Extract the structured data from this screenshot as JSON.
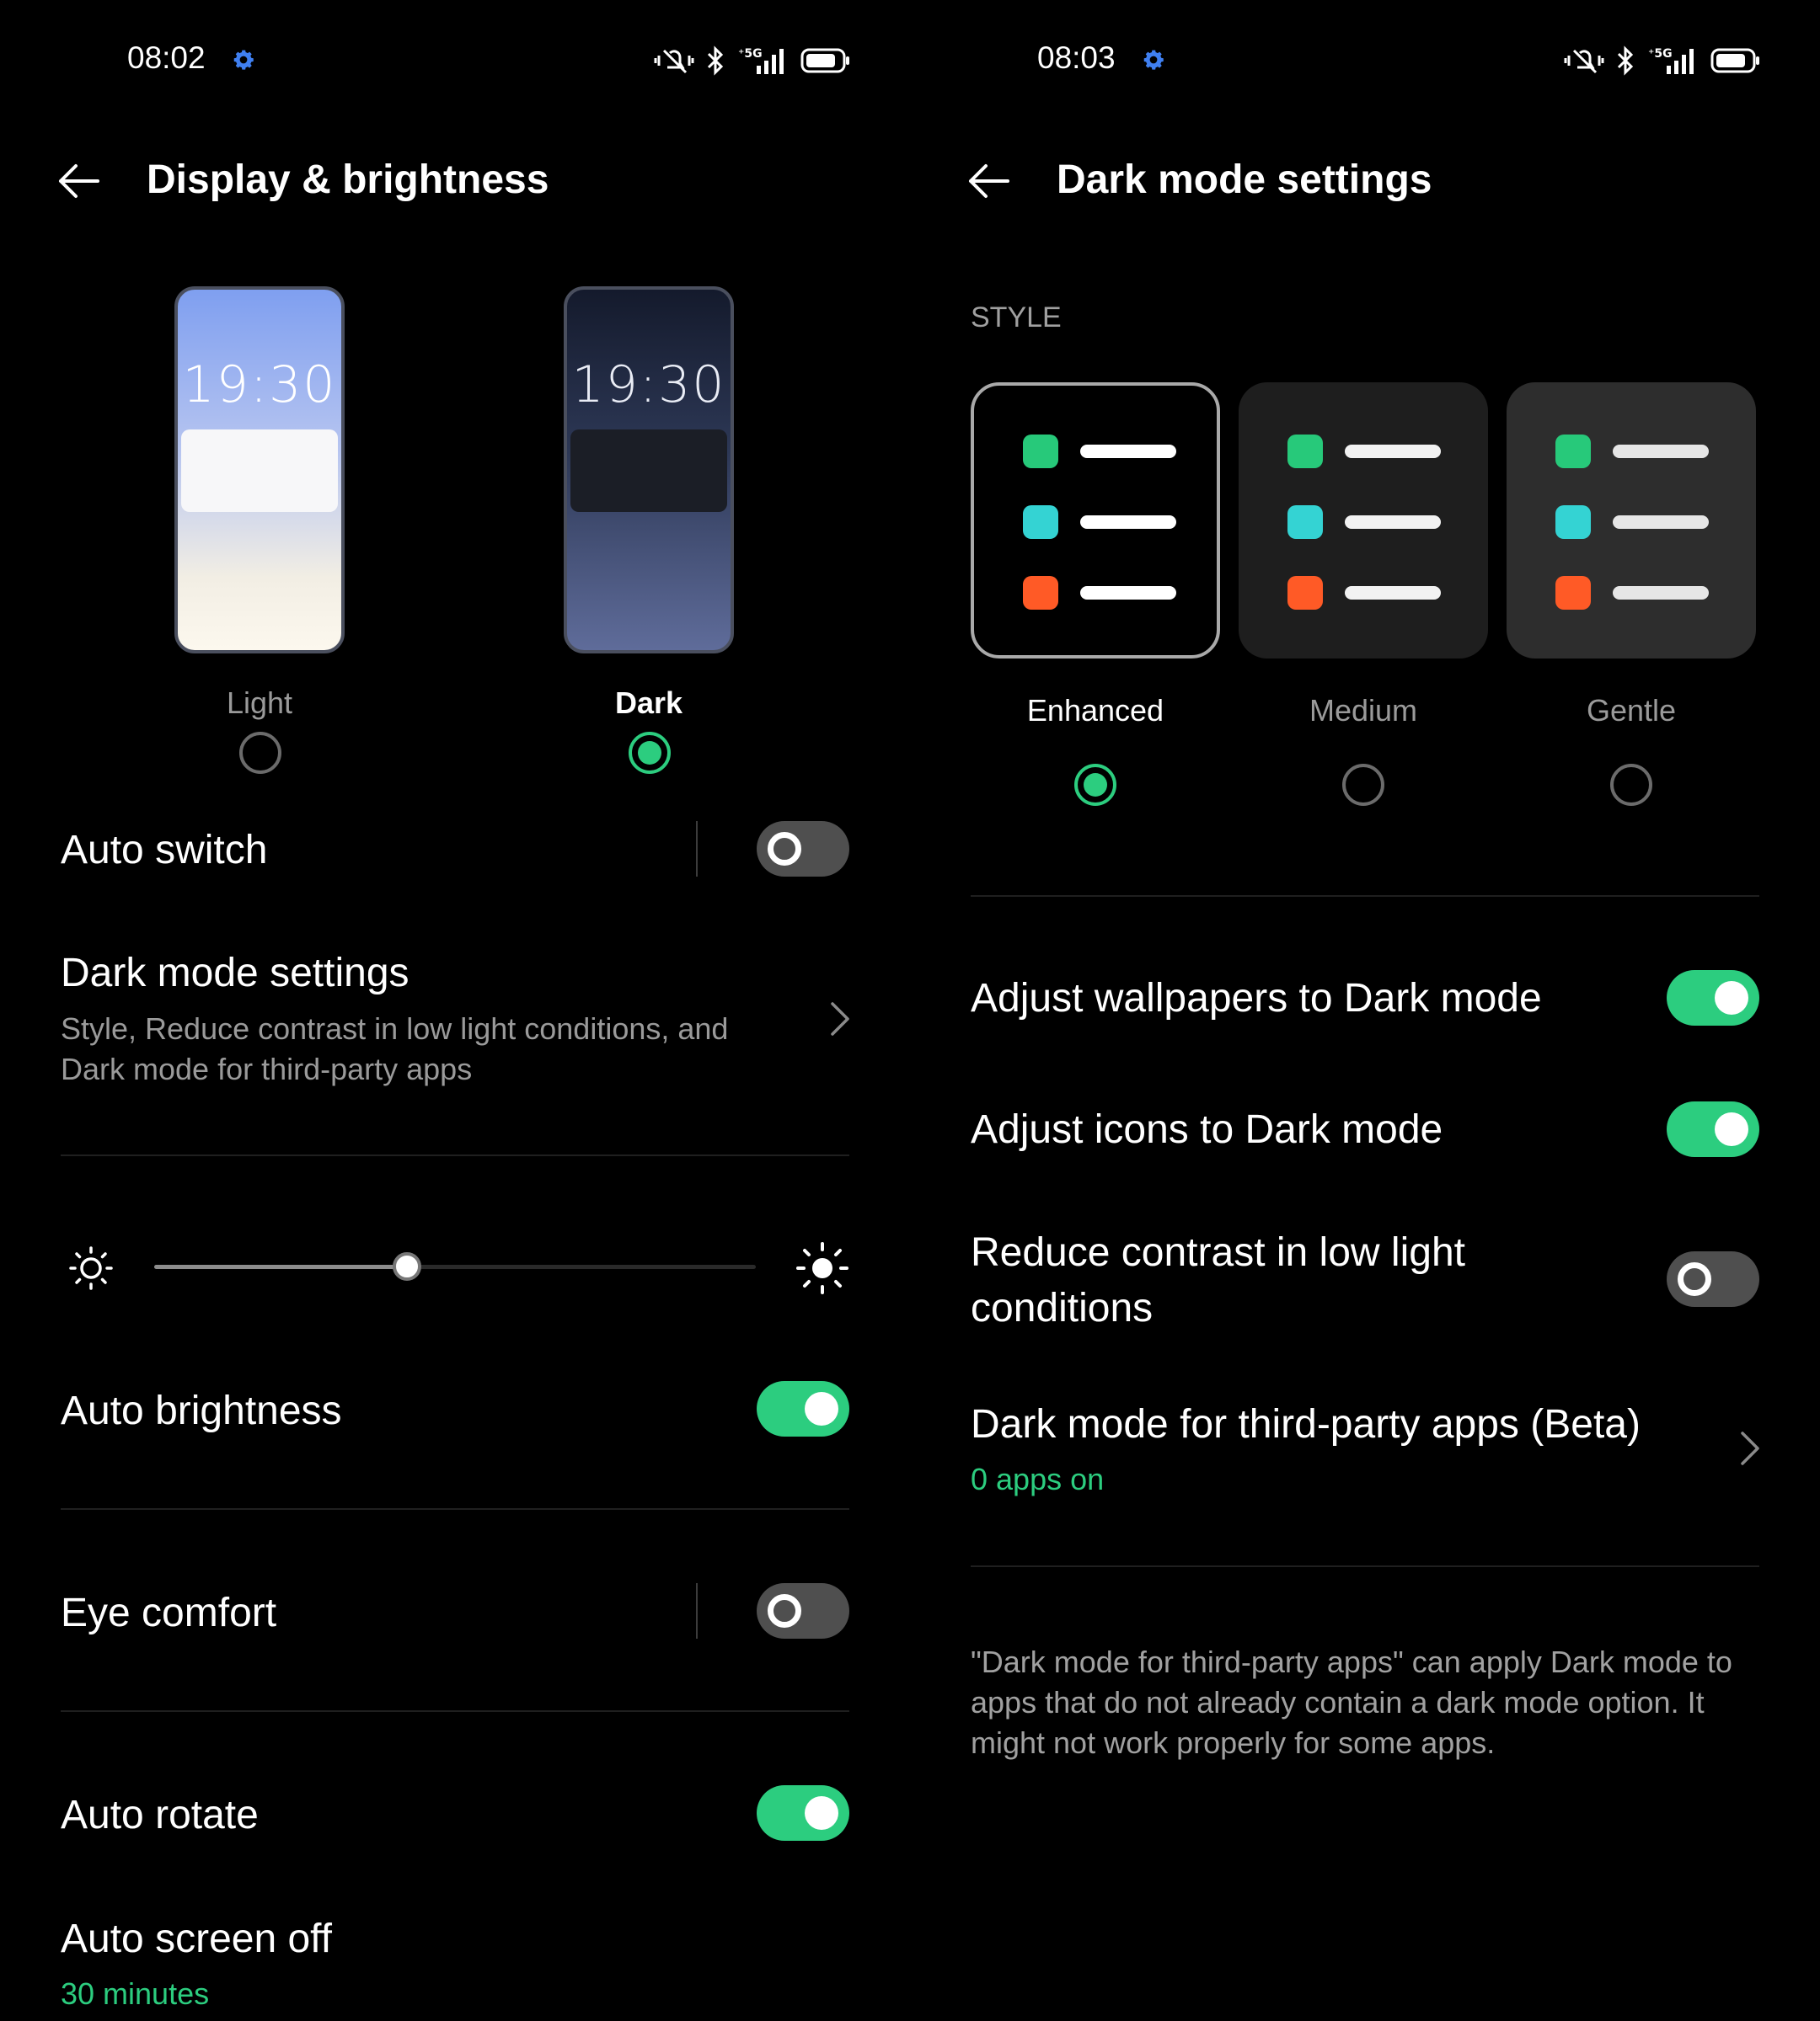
{
  "colors": {
    "accent": "#2ccd7f",
    "gear": "#3f7ff0",
    "background": "#000000"
  },
  "left": {
    "status_time": "08:02",
    "status_icons": [
      "settings-gear-icon",
      "vibrate-icon",
      "bluetooth-icon",
      "5g-signal-icon",
      "battery-icon"
    ],
    "title": "Display & brightness",
    "modes": [
      {
        "label": "Light",
        "preview_time": "19:30",
        "selected": false
      },
      {
        "label": "Dark",
        "preview_time": "19:30",
        "selected": true
      }
    ],
    "auto_switch": {
      "label": "Auto switch",
      "on": false
    },
    "dark_mode_settings": {
      "label": "Dark mode settings",
      "subtitle_line1": "Style, Reduce contrast in low light conditions, and",
      "subtitle_line2": "Dark mode for third-party apps"
    },
    "brightness": {
      "level": 0.42
    },
    "auto_brightness": {
      "label": "Auto brightness",
      "on": true
    },
    "eye_comfort": {
      "label": "Eye comfort",
      "on": false
    },
    "auto_rotate": {
      "label": "Auto rotate",
      "on": true
    },
    "auto_screen_off": {
      "label": "Auto screen off",
      "value": "30 minutes"
    }
  },
  "right": {
    "status_time": "08:03",
    "title": "Dark mode settings",
    "section_header": "STYLE",
    "styles": [
      {
        "label": "Enhanced",
        "selected": true
      },
      {
        "label": "Medium",
        "selected": false
      },
      {
        "label": "Gentle",
        "selected": false
      }
    ],
    "style_icon_colors": [
      "#27c97a",
      "#34d3d3",
      "#ff5a26"
    ],
    "adjust_wallpapers": {
      "label": "Adjust wallpapers to Dark mode",
      "on": true
    },
    "adjust_icons": {
      "label": "Adjust icons to Dark mode",
      "on": true
    },
    "reduce_contrast": {
      "label_line1": "Reduce contrast in low light",
      "label_line2": "conditions",
      "on": false
    },
    "third_party": {
      "label": "Dark mode for third-party apps (Beta)",
      "status": "0 apps on"
    },
    "note_line1": "\"Dark mode for third-party apps\" can apply Dark mode to",
    "note_line2": "apps that do not already contain a dark mode option. It",
    "note_line3": "might not work properly for some apps."
  }
}
